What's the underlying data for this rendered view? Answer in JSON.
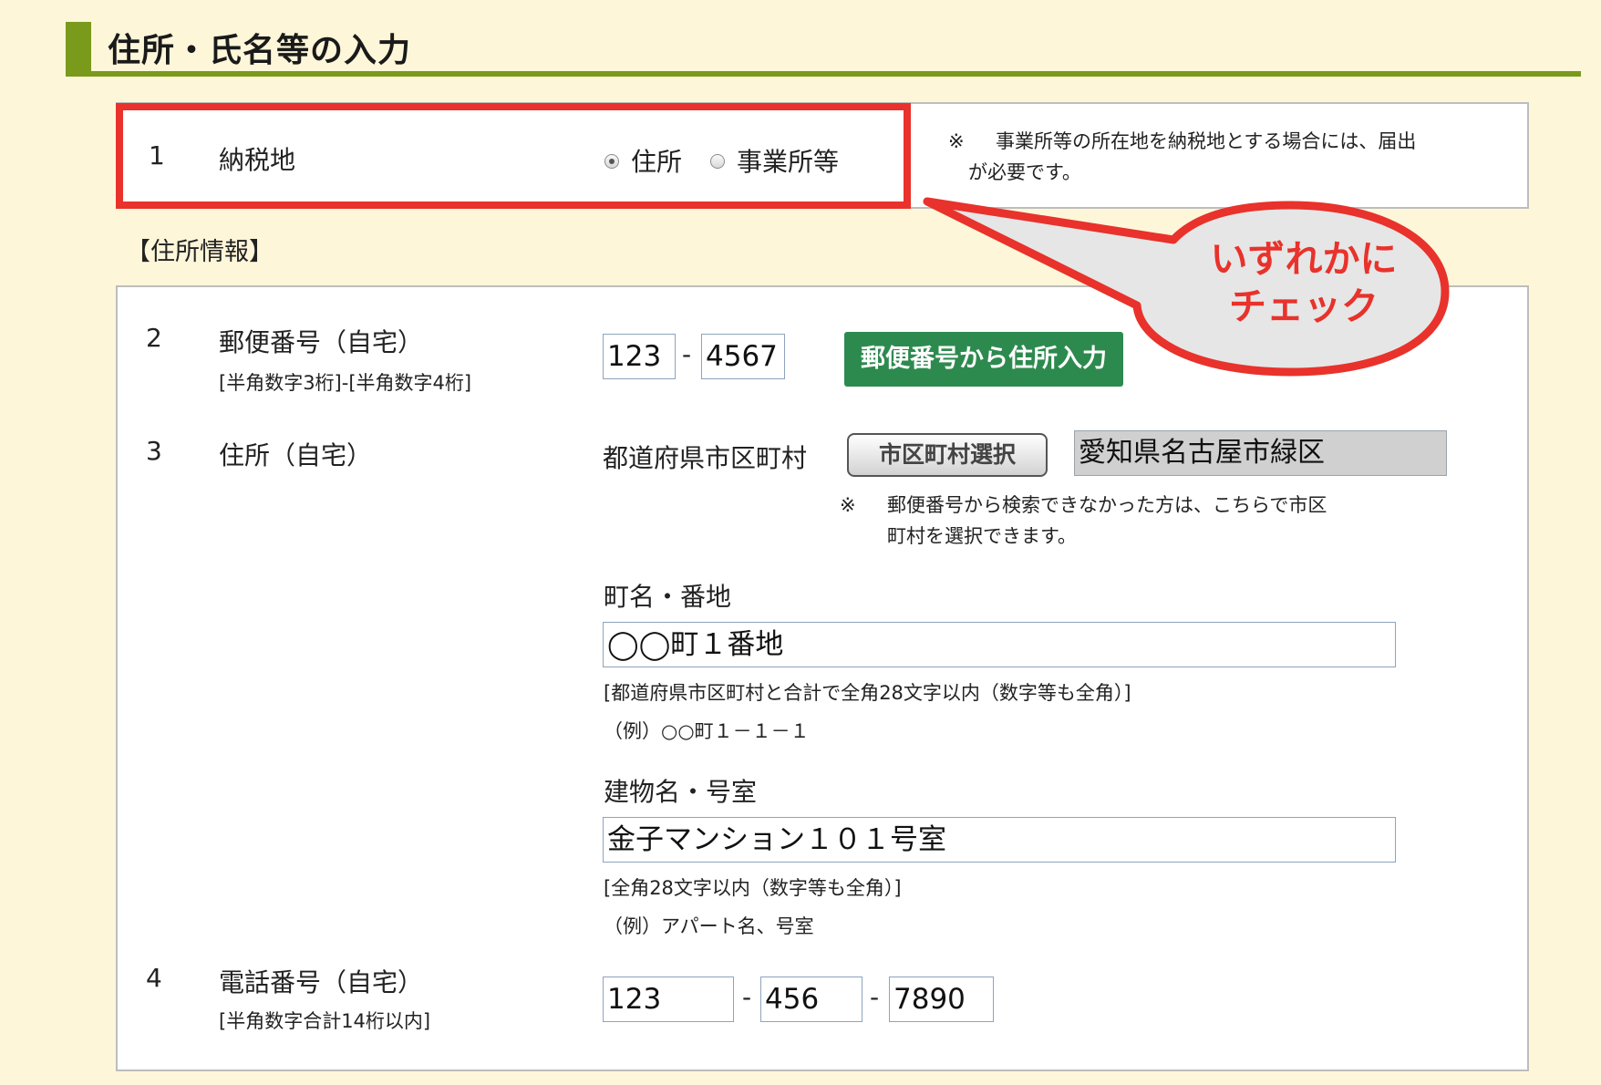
{
  "header": {
    "title": "住所・氏名等の入力"
  },
  "row1": {
    "number": "1",
    "label": "納税地",
    "radio_address": "住所",
    "radio_business": "事業所等",
    "note_mark": "※",
    "note_line1": "事業所等の所在地を納税地とする場合には、届出",
    "note_line2": "が必要です。"
  },
  "address_info_title": "【住所情報】",
  "row2": {
    "number": "2",
    "label": "郵便番号（自宅）",
    "hint": "[半角数字3桁]-[半角数字4桁]",
    "zip1": "123",
    "dash": "-",
    "zip2": "4567",
    "button": "郵便番号から住所入力"
  },
  "row3": {
    "number": "3",
    "label": "住所（自宅）",
    "pref_label": "都道府県市区町村",
    "city_button": "市区町村選択",
    "pref_value": "愛知県名古屋市緑区",
    "city_note_mark": "※",
    "city_note_line1": "郵便番号から検索できなかった方は、こちらで市区",
    "city_note_line2": "町村を選択できます。",
    "town_label": "町名・番地",
    "town_value": "◯◯町１番地",
    "town_hint": "[都道府県市区町村と合計で全角28文字以内（数字等も全角）]",
    "town_example": "（例）○○町１－１－１",
    "building_label": "建物名・号室",
    "building_value": "金子マンション１０１号室",
    "building_hint": "[全角28文字以内（数字等も全角）]",
    "building_example": "（例）アパート名、号室"
  },
  "row4": {
    "number": "4",
    "label": "電話番号（自宅）",
    "hint": "[半角数字合計14桁以内]",
    "tel1": "123",
    "tel2": "456",
    "tel3": "7890",
    "dash": "-"
  },
  "callout": {
    "line1": "いずれかに",
    "line2": "チェック"
  },
  "colors": {
    "accent_green": "#7a9a1c",
    "button_green": "#2d8a4e",
    "highlight_red": "#e8322b",
    "background": "#fdf6d9"
  },
  "selected_radio": "住所"
}
